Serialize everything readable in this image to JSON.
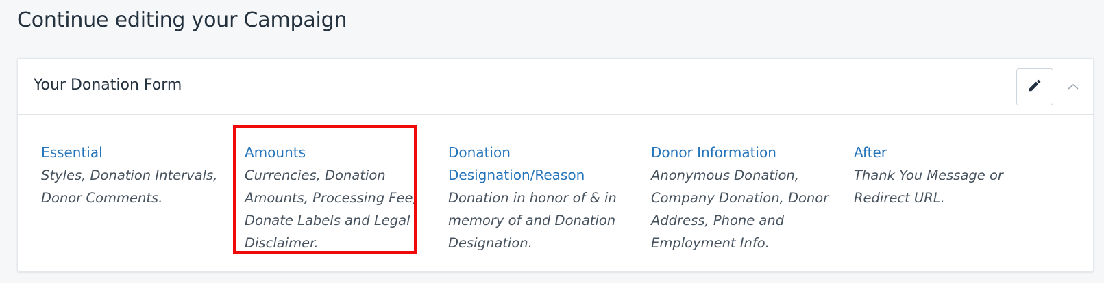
{
  "page": {
    "title": "Continue editing your Campaign"
  },
  "card": {
    "title": "Your Donation Form",
    "edit_icon": "pencil-icon",
    "collapse_icon": "chevron-up-icon"
  },
  "sections": [
    {
      "title": "Essential",
      "description": "Styles, Donation Intervals, Donor Comments."
    },
    {
      "title": "Amounts",
      "description": "Currencies, Donation Amounts, Processing Fee, Donate Labels and Legal Disclaimer."
    },
    {
      "title": "Donation Designation/Reason",
      "description": "Donation in honor of & in memory of and Donation Designation."
    },
    {
      "title": "Donor Information",
      "description": "Anonymous Donation, Company Donation, Donor Address, Phone and Employment Info."
    },
    {
      "title": "After",
      "description": "Thank You Message or Redirect URL."
    }
  ],
  "colors": {
    "link": "#2474bb",
    "highlight": "#f00a0a"
  }
}
